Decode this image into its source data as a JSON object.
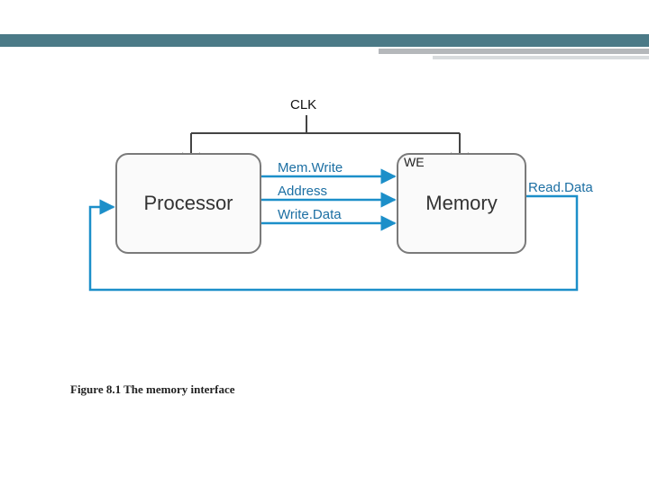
{
  "header": {
    "bar_color": "#4b7a87"
  },
  "diagram": {
    "clk_label": "CLK",
    "blocks": {
      "processor": "Processor",
      "memory": "Memory"
    },
    "signals": {
      "mem_write": "Mem.Write",
      "address": "Address",
      "write_data": "Write.Data",
      "read_data": "Read.Data",
      "we": "WE"
    }
  },
  "caption": "Figure 8.1 The memory interface",
  "chart_data": {
    "type": "diagram",
    "title": "Figure 8.1 The memory interface",
    "nodes": [
      {
        "id": "processor",
        "label": "Processor"
      },
      {
        "id": "memory",
        "label": "Memory"
      }
    ],
    "global_signals": [
      {
        "name": "CLK",
        "targets": [
          "processor",
          "memory"
        ]
      }
    ],
    "edges": [
      {
        "from": "processor",
        "to": "memory",
        "label": "Mem.Write",
        "maps_to": "WE"
      },
      {
        "from": "processor",
        "to": "memory",
        "label": "Address"
      },
      {
        "from": "processor",
        "to": "memory",
        "label": "Write.Data"
      },
      {
        "from": "memory",
        "to": "processor",
        "label": "Read.Data",
        "routed": "feedback_bottom"
      }
    ],
    "annotations": [
      {
        "text": "WE",
        "at": "memory",
        "corner": "top-left"
      }
    ]
  }
}
